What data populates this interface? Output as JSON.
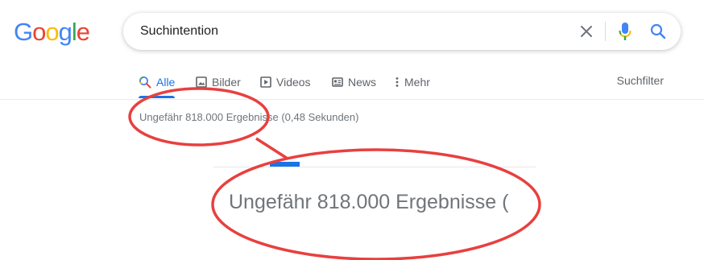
{
  "logo": {
    "letters": [
      "G",
      "o",
      "o",
      "g",
      "l",
      "e"
    ],
    "colors": [
      "#4285F4",
      "#EA4335",
      "#FBBC05",
      "#4285F4",
      "#34A853",
      "#EA4335"
    ]
  },
  "search": {
    "query": "Suchintention",
    "icons": {
      "clear": "close-icon",
      "voice": "microphone-icon",
      "submit": "search-icon"
    }
  },
  "tabs": {
    "items": [
      {
        "label": "Alle",
        "icon": "search-icon",
        "active": true
      },
      {
        "label": "Bilder",
        "icon": "image-icon",
        "active": false
      },
      {
        "label": "Videos",
        "icon": "play-icon",
        "active": false
      },
      {
        "label": "News",
        "icon": "news-icon",
        "active": false
      },
      {
        "label": "Mehr",
        "icon": "more-vert-icon",
        "active": false
      }
    ],
    "tools_label": "Suchfilter"
  },
  "results": {
    "stats": "Ungefähr 818.000 Ergebnisse (0,48 Sekunden)",
    "zoomed_stats": "Ungefähr 818.000 Ergebnisse ("
  },
  "colors": {
    "accent": "#1a73e8",
    "annotation": "#e8403f",
    "secondary_text": "#70757a"
  }
}
